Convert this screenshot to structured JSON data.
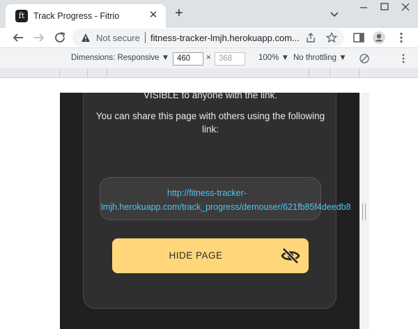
{
  "browser": {
    "tab": {
      "title": "Track Progress - Fitrio",
      "favicon": "fitrio-logo"
    },
    "address": {
      "security_label": "Not secure",
      "url": "fitness-tracker-lmjh.herokuapp.com..."
    }
  },
  "devtools": {
    "dimensions_label": "Dimensions: Responsive ▼",
    "width": "460",
    "height_placeholder": "368",
    "times": "×",
    "zoom": "100% ▼",
    "throttling": "No throttling ▼"
  },
  "page": {
    "visibility_message": "Your progress with this routine is currently VISIBLE to anyone with the link.",
    "share_message_1": "You can share this page with others using the following",
    "share_message_2": "link:",
    "share_link_line1": "http://fitness-tracker-",
    "share_link_line2": "lmjh.herokuapp.com/track_progress/demouser/621fb85f4deedb8",
    "hide_button_label": "HIDE PAGE",
    "colors": {
      "page_background": "#202020",
      "card_background": "#2f2f2f",
      "link": "#4fc3f7",
      "button": "#ffd77a"
    }
  }
}
